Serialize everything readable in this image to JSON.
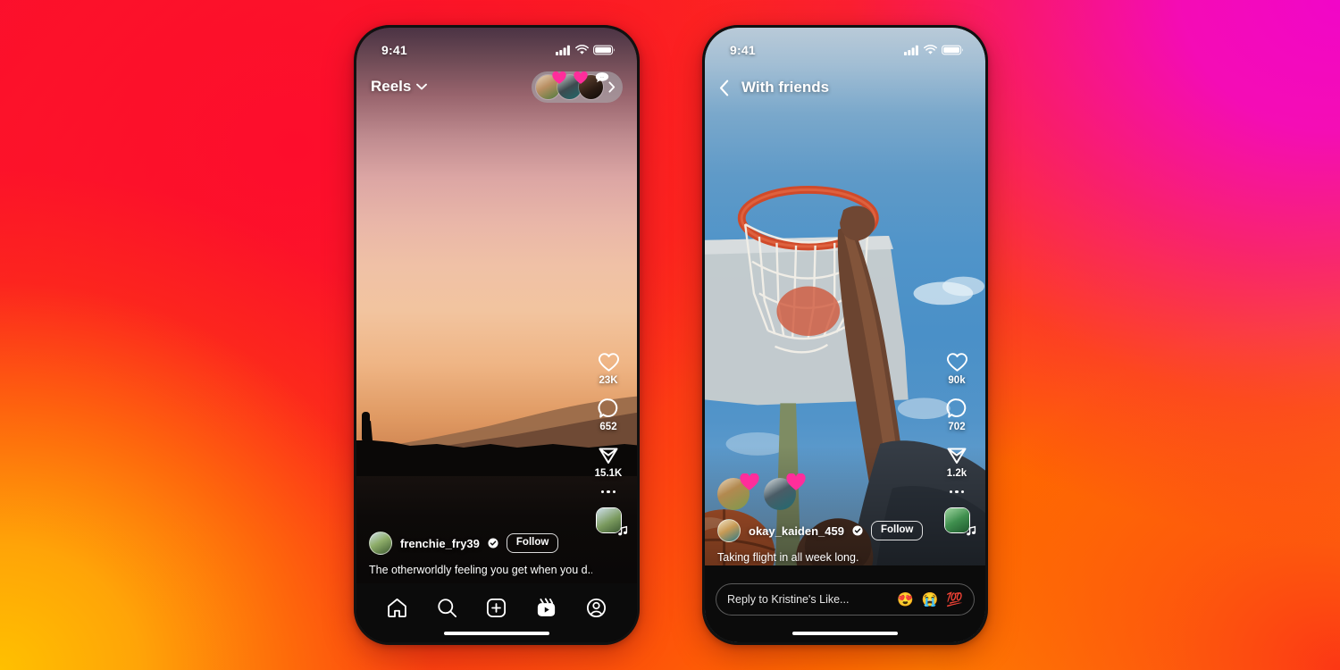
{
  "background": {
    "colors": {
      "top_left_red": "#FB0D2E",
      "top_right_magenta": "#EE06C0",
      "bottom_left_orange": "#FFA50A",
      "bottom_right_red_orange": "#FB2118"
    }
  },
  "phones": [
    {
      "id": "reels-feed",
      "status_bar": {
        "time": "9:41",
        "icons": [
          "cellular-signal-icon",
          "wifi-icon",
          "battery-icon"
        ]
      },
      "header": {
        "title": "Reels",
        "chevron": "chevron-down-icon",
        "story_tray": {
          "avatars": [
            {
              "reaction": "heart",
              "reaction_color": "#FF2D9B"
            },
            {
              "reaction": "heart",
              "reaction_color": "#FF2D9B"
            },
            {
              "reaction": "speech-bubble",
              "reaction_color": "#FFFFFF"
            }
          ],
          "chevron": "chevron-right-icon"
        }
      },
      "video": {
        "description": "sunset over hills with dark silhouetted foreground"
      },
      "rail": [
        {
          "icon": "heart-icon",
          "name": "like",
          "count": "23K"
        },
        {
          "icon": "comment-icon",
          "name": "comment",
          "count": "652"
        },
        {
          "icon": "share-icon",
          "name": "share",
          "count": "15.1K"
        }
      ],
      "more_icon": "more-options-icon",
      "audio_icon": "music-note-icon",
      "post": {
        "username": "frenchie_fry39",
        "verified": true,
        "follow_label": "Follow",
        "caption": "The otherworldly feeling you get when you d..."
      },
      "nav": [
        {
          "icon": "home-icon",
          "label": "Home",
          "active": false
        },
        {
          "icon": "search-icon",
          "label": "Search",
          "active": false
        },
        {
          "icon": "create-icon",
          "label": "Create",
          "active": false
        },
        {
          "icon": "reels-icon",
          "label": "Reels",
          "active": true
        },
        {
          "icon": "profile-icon",
          "label": "Profile",
          "active": false
        }
      ]
    },
    {
      "id": "with-friends",
      "status_bar": {
        "time": "9:41",
        "icons": [
          "cellular-signal-icon",
          "wifi-icon",
          "battery-icon"
        ]
      },
      "header": {
        "back_icon": "chevron-left-icon",
        "title": "With friends"
      },
      "video": {
        "description": "basketball hoop viewed from below against blue sky, player dunking"
      },
      "friend_reactions": [
        {
          "reaction": "heart",
          "reaction_color": "#FF2D9B"
        },
        {
          "reaction": "heart",
          "reaction_color": "#FF2D9B"
        }
      ],
      "rail": [
        {
          "icon": "heart-icon",
          "name": "like",
          "count": "90k"
        },
        {
          "icon": "comment-icon",
          "name": "comment",
          "count": "702"
        },
        {
          "icon": "share-icon",
          "name": "share",
          "count": "1.2k"
        }
      ],
      "more_icon": "more-options-icon",
      "audio_icon": "music-note-icon",
      "post": {
        "username": "okay_kaiden_459",
        "verified": true,
        "follow_label": "Follow",
        "caption": "Taking flight in all week long."
      },
      "reply": {
        "placeholder": "Reply to Kristine's Like...",
        "emojis": [
          "😍",
          "😭",
          "💯"
        ]
      }
    }
  ]
}
